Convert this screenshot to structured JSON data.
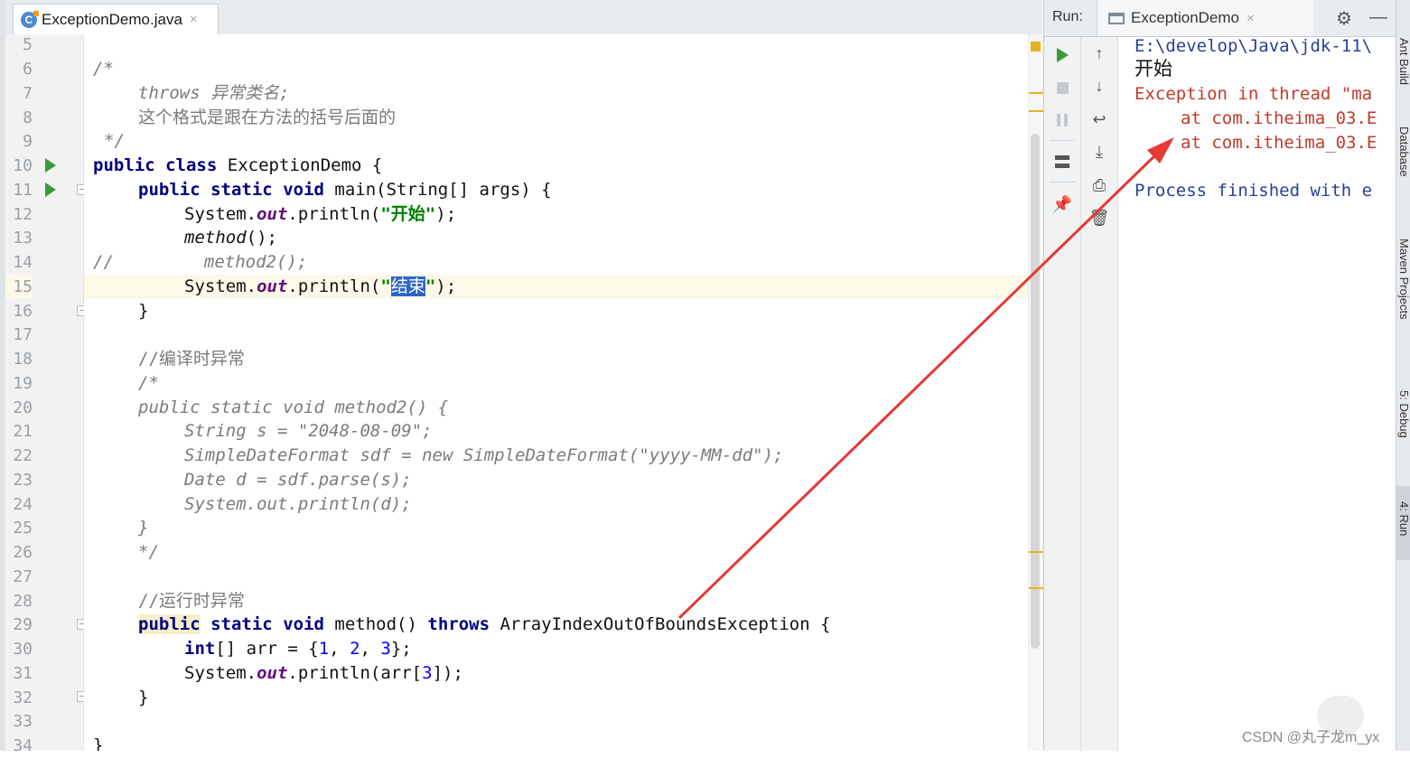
{
  "editor": {
    "tab": {
      "filename": "ExceptionDemo.java",
      "close": "×",
      "icon": "java-class-icon"
    },
    "lines": [
      {
        "n": "5"
      },
      {
        "n": "6"
      },
      {
        "n": "7"
      },
      {
        "n": "8"
      },
      {
        "n": "9"
      },
      {
        "n": "10"
      },
      {
        "n": "11"
      },
      {
        "n": "12"
      },
      {
        "n": "13"
      },
      {
        "n": "14"
      },
      {
        "n": "15"
      },
      {
        "n": "16"
      },
      {
        "n": "17"
      },
      {
        "n": "18"
      },
      {
        "n": "19"
      },
      {
        "n": "20"
      },
      {
        "n": "21"
      },
      {
        "n": "22"
      },
      {
        "n": "23"
      },
      {
        "n": "24"
      },
      {
        "n": "25"
      },
      {
        "n": "26"
      },
      {
        "n": "27"
      },
      {
        "n": "28"
      },
      {
        "n": "29"
      },
      {
        "n": "30"
      },
      {
        "n": "31"
      },
      {
        "n": "32"
      },
      {
        "n": "33"
      },
      {
        "n": "34"
      }
    ],
    "code": {
      "l6": "/*",
      "l7": "throws 异常类名;",
      "l8": "这个格式是跟在方法的括号后面的",
      "l9": "*/",
      "l10_kw1": "public",
      "l10_kw2": "class",
      "l10_name": "ExceptionDemo {",
      "l11_kw1": "public",
      "l11_kw2": "static",
      "l11_kw3": "void",
      "l11_rest": "main(String[] args) {",
      "l12_sys": "System.",
      "l12_out": "out",
      "l12_println": ".println(",
      "l12_str": "\"开始\"",
      "l12_end": ");",
      "l13_method": "method",
      "l13_end": "();",
      "l14_comment": "//",
      "l14_method2": "method2();",
      "l15_sys": "System.",
      "l15_out": "out",
      "l15_println": ".println(",
      "l15_q1": "\"",
      "l15_sel": "结束",
      "l15_q2": "\"",
      "l15_end": ");",
      "l16": "}",
      "l18": "//编译时异常",
      "l19": "/*",
      "l20": "public static void method2() {",
      "l21": "String s = \"2048-08-09\";",
      "l22": "SimpleDateFormat sdf = new SimpleDateFormat(\"yyyy-MM-dd\");",
      "l23": "Date d = sdf.parse(s);",
      "l24": "System.out.println(d);",
      "l25": "}",
      "l26": "*/",
      "l28": "//运行时异常",
      "l29_kw1": "public",
      "l29_kw2": "static",
      "l29_kw3": "void",
      "l29_mid": "method()",
      "l29_kw4": "throws",
      "l29_rest": "ArrayIndexOutOfBoundsException {",
      "l30_kw": "int",
      "l30_a": "[] arr = {",
      "l30_n1": "1",
      "l30_c1": ", ",
      "l30_n2": "2",
      "l30_c2": ", ",
      "l30_n3": "3",
      "l30_end": "};",
      "l31_sys": "System.",
      "l31_out": "out",
      "l31_println": ".println(arr[",
      "l31_n": "3",
      "l31_end": "]);",
      "l32": "}",
      "l34": "}"
    }
  },
  "run": {
    "label": "Run:",
    "tab": {
      "name": "ExceptionDemo",
      "close": "×"
    },
    "console": {
      "path": "E:\\develop\\Java\\jdk-11\\",
      "out": "开始",
      "exception": "Exception in thread \"ma",
      "at1": "at com.itheima_03.E",
      "at2": "at com.itheima_03.E",
      "finished": "Process finished with e"
    }
  },
  "sidebar": {
    "items": [
      {
        "label": "Ant Build"
      },
      {
        "label": "Database"
      },
      {
        "label": "Maven Projects"
      },
      {
        "label": "5: Debug"
      },
      {
        "label": "4: Run"
      }
    ]
  },
  "watermark": "CSDN @丸子龙m_yx",
  "colors": {
    "accent_run": "#3a9b3a",
    "arrow": "#e53935",
    "keyword": "#000080",
    "string": "#008000",
    "selection": "#2f65ca"
  }
}
